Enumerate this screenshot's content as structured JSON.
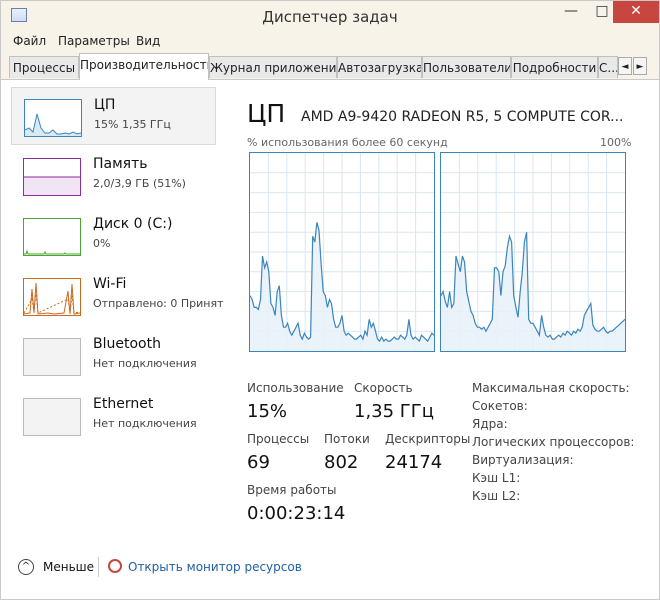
{
  "window": {
    "title": "Диспетчер задач"
  },
  "window_buttons": {
    "minimize": "—",
    "maximize": "□",
    "close": "✕"
  },
  "menu": [
    "Файл",
    "Параметры",
    "Вид"
  ],
  "tabs": [
    "Процессы",
    "Производительность",
    "Журнал приложений",
    "Автозагрузка",
    "Пользователи",
    "Подробности",
    "С..."
  ],
  "tab_scroll": {
    "left": "◄",
    "right": "►"
  },
  "sidebar": [
    {
      "title": "ЦП",
      "sub": "15%  1,35 ГГц",
      "color": "#3a86ba"
    },
    {
      "title": "Память",
      "sub": "2,0/3,9 ГБ (51%)",
      "color": "#8b2e9e"
    },
    {
      "title": "Диск 0 (C:)",
      "sub": "0%",
      "color": "#4aa832"
    },
    {
      "title": "Wi-Fi",
      "sub": "Отправлено: 0 Принят",
      "color": "#c96a20"
    },
    {
      "title": "Bluetooth",
      "sub": "Нет подключения",
      "color": "#aaaaaa"
    },
    {
      "title": "Ethernet",
      "sub": "Нет подключения",
      "color": "#aaaaaa"
    }
  ],
  "cpu": {
    "heading": "ЦП",
    "model": "AMD A9-9420 RADEON R5, 5 COMPUTE COR...",
    "graph_label": "% использования более 60 секунд",
    "graph_max": "100%",
    "line_color": "#3a86ba",
    "core1": [
      28,
      26,
      22,
      22,
      21,
      26,
      48,
      42,
      45,
      40,
      24,
      22,
      18,
      30,
      33,
      18,
      12,
      12,
      14,
      10,
      8,
      10,
      12,
      14,
      8,
      6,
      9,
      7,
      6,
      7,
      58,
      55,
      65,
      61,
      44,
      30,
      28,
      22,
      26,
      24,
      16,
      12,
      12,
      14,
      18,
      10,
      8,
      9,
      8,
      7,
      6,
      6,
      7,
      8,
      6,
      10,
      8,
      16,
      12,
      14,
      10,
      6,
      5,
      7,
      5,
      6,
      5,
      5,
      6,
      7,
      6,
      6,
      8,
      7,
      6,
      8,
      16,
      8,
      6,
      7,
      6,
      5,
      8,
      7,
      6,
      5,
      7,
      9,
      8
    ],
    "core2": [
      28,
      30,
      25,
      22,
      30,
      22,
      24,
      48,
      44,
      40,
      48,
      45,
      30,
      25,
      20,
      18,
      14,
      12,
      12,
      11,
      12,
      10,
      12,
      14,
      16,
      42,
      42,
      40,
      28,
      40,
      43,
      52,
      58,
      55,
      28,
      22,
      17,
      30,
      40,
      55,
      60,
      16,
      14,
      14,
      12,
      10,
      8,
      18,
      12,
      8,
      7,
      8,
      6,
      6,
      7,
      8,
      7,
      9,
      8,
      10,
      9,
      8,
      10,
      9,
      11,
      10,
      12,
      18,
      20,
      22,
      24,
      13,
      11,
      10,
      10,
      11,
      12,
      10,
      9,
      10,
      10,
      11,
      12,
      13,
      14,
      15,
      16
    ],
    "stats": {
      "usage_label": "Использование",
      "usage_value": "15%",
      "speed_label": "Скорость",
      "speed_value": "1,35 ГГц",
      "processes_label": "Процессы",
      "processes_value": "69",
      "threads_label": "Потоки",
      "threads_value": "802",
      "handles_label": "Дескрипторы",
      "handles_value": "24174",
      "uptime_label": "Время работы",
      "uptime_value": "0:00:23:14"
    },
    "specs": [
      "Максимальная скорость:",
      "Сокетов:",
      "Ядра:",
      "Логических процессоров:",
      "Виртуализация:",
      "Кэш L1:",
      "Кэш L2:"
    ]
  },
  "footer": {
    "less": "Меньше",
    "less_icon": "chevron-up-icon",
    "monitor_link": "Открыть монитор ресурсов",
    "monitor_icon": "resource-monitor-icon"
  }
}
